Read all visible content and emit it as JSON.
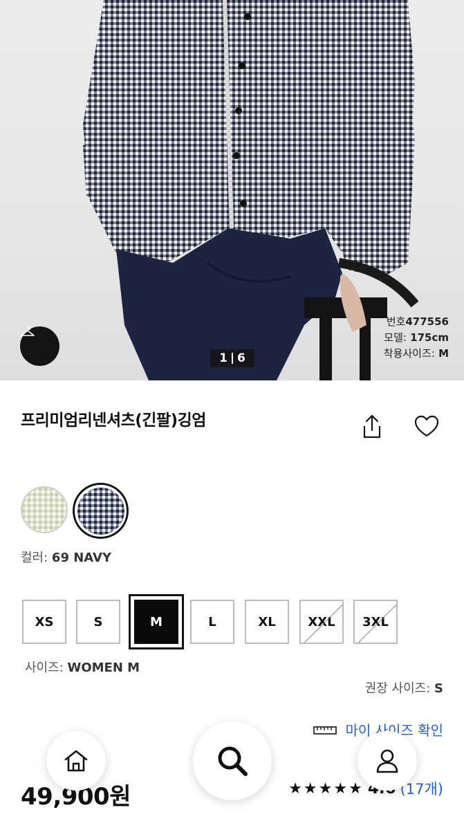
{
  "gallery": {
    "pager_current": "1",
    "pager_total": "6",
    "model_info": {
      "product_no_label": "번호",
      "product_no": "477556",
      "model_label": "모델:",
      "model_height": "175cm",
      "fit_size_label": "착용사이즈:",
      "fit_size": "M"
    },
    "hanger_icon": "hanger-icon"
  },
  "product": {
    "title": "프리미엄리넨셔츠(긴팔)깅엄",
    "share_icon": "share-icon",
    "wishlist_icon": "heart-icon"
  },
  "colors": {
    "label": "컬러:",
    "selected": "69 NAVY",
    "swatches": [
      {
        "name": "green-gingham",
        "hex": "#d8ddc6",
        "selected": false
      },
      {
        "name": "navy-gingham",
        "hex": "#1d2540",
        "selected": true
      }
    ]
  },
  "sizes": {
    "options": [
      {
        "label": "XS",
        "available": true,
        "selected": false
      },
      {
        "label": "S",
        "available": true,
        "selected": false
      },
      {
        "label": "M",
        "available": true,
        "selected": true
      },
      {
        "label": "L",
        "available": true,
        "selected": false
      },
      {
        "label": "XL",
        "available": true,
        "selected": false
      },
      {
        "label": "XXL",
        "available": false,
        "selected": false
      },
      {
        "label": "3XL",
        "available": false,
        "selected": false
      }
    ],
    "label": "사이즈:",
    "selected": "WOMEN M",
    "recommended_label": "권장 사이즈:",
    "recommended": "S"
  },
  "my_size": {
    "link": "마이 사이즈 확인",
    "icon": "ruler-icon"
  },
  "price": "49,900원",
  "rating": {
    "stars": 4.5,
    "score": "4.6",
    "count": "(17개)"
  },
  "nav": {
    "home_icon": "home-icon",
    "search_icon": "search-icon",
    "account_icon": "user-icon"
  },
  "theme": {
    "accent": "#2f5fb4",
    "black": "#0a0a0a",
    "navy": "#1d2540"
  }
}
